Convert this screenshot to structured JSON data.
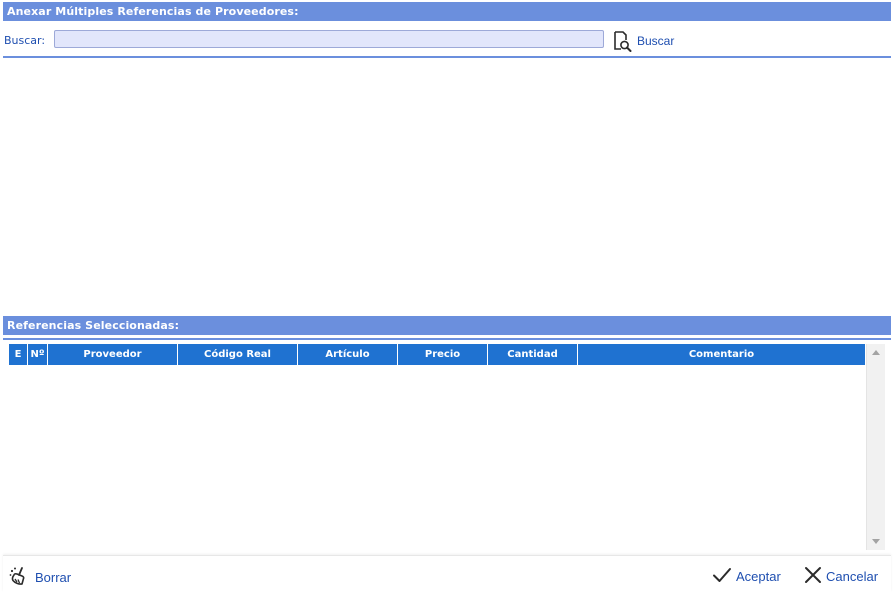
{
  "header_top": {
    "title": "Anexar Múltiples Referencias de Proveedores:"
  },
  "search": {
    "label": "Buscar:",
    "value": "",
    "placeholder": "",
    "button_label": "Buscar",
    "button_icon": "magnifier-document-icon"
  },
  "header_selected": {
    "title": "Referencias Seleccionadas:"
  },
  "grid": {
    "columns": [
      "E",
      "Nº",
      "Proveedor",
      "Código Real",
      "Artículo",
      "Precio",
      "Cantidad",
      "Comentario"
    ],
    "rows": []
  },
  "footer": {
    "borrar_label": "Borrar",
    "borrar_icon": "broom-icon",
    "aceptar_label": "Aceptar",
    "aceptar_icon": "checkmark-icon",
    "cancelar_label": "Cancelar",
    "cancelar_icon": "close-icon"
  },
  "colors": {
    "header_bg": "#6b8fdd",
    "grid_header_bg": "#1f72d1",
    "link_text": "#1f4fb0",
    "input_bg": "#e2e6fb"
  }
}
